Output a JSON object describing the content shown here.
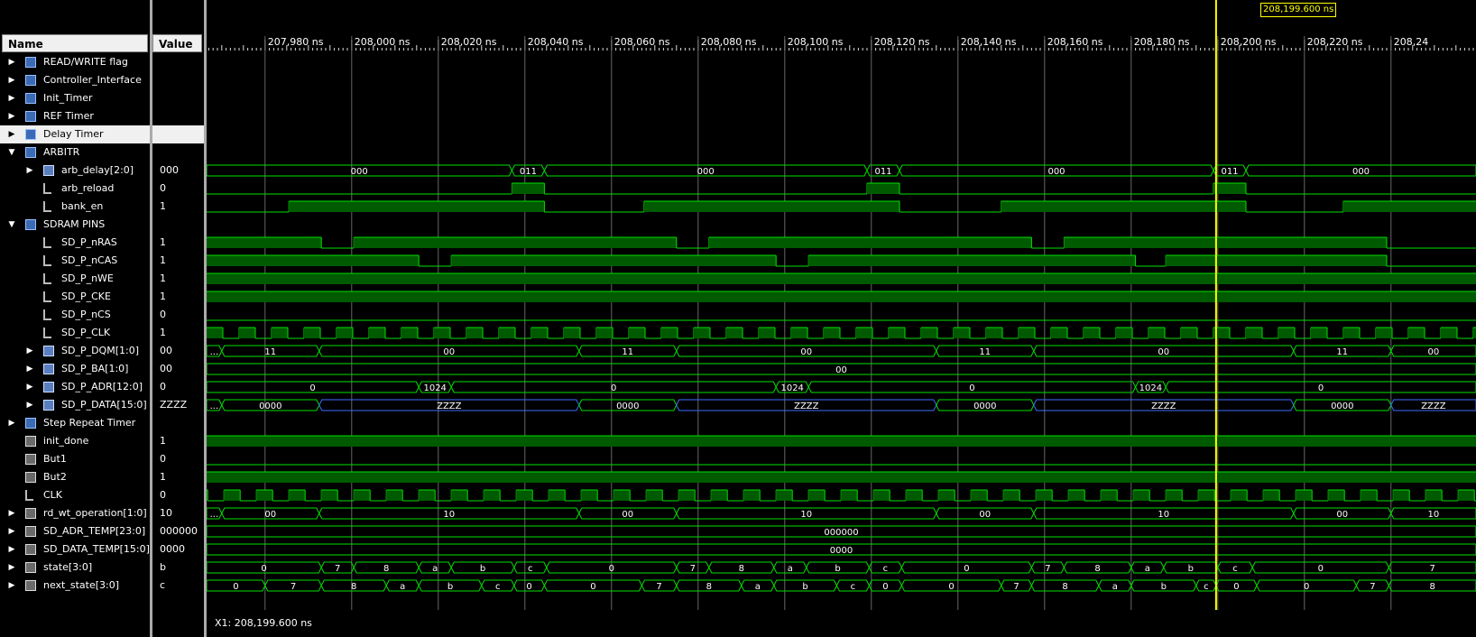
{
  "headers": {
    "name": "Name",
    "value": "Value"
  },
  "cursor": {
    "label": "208,199.600 ns",
    "x1": "X1: 208,199.600 ns"
  },
  "timeline": {
    "start_ns": 207966.5,
    "ticks": [
      {
        "t": 207980,
        "label": "207,980 ns"
      },
      {
        "t": 208000,
        "label": "208,000 ns"
      },
      {
        "t": 208020,
        "label": "208,020 ns"
      },
      {
        "t": 208040,
        "label": "208,040 ns"
      },
      {
        "t": 208060,
        "label": "208,060 ns"
      },
      {
        "t": 208080,
        "label": "208,080 ns"
      },
      {
        "t": 208100,
        "label": "208,100 ns"
      },
      {
        "t": 208120,
        "label": "208,120 ns"
      },
      {
        "t": 208140,
        "label": "208,140 ns"
      },
      {
        "t": 208160,
        "label": "208,160 ns"
      },
      {
        "t": 208180,
        "label": "208,180 ns"
      },
      {
        "t": 208200,
        "label": "208,200 ns"
      },
      {
        "t": 208220,
        "label": "208,220 ns"
      },
      {
        "t": 208240,
        "label": "208,24"
      }
    ]
  },
  "signals": [
    {
      "name": "READ/WRITE flag",
      "value": "",
      "icon": "group-icon",
      "level": 0,
      "expander": "collapsed"
    },
    {
      "name": "Controller_Interface",
      "value": "",
      "icon": "group-icon",
      "level": 0,
      "expander": "collapsed"
    },
    {
      "name": "Init_Timer",
      "value": "",
      "icon": "group-icon",
      "level": 0,
      "expander": "collapsed"
    },
    {
      "name": "REF Timer",
      "value": "",
      "icon": "group-icon",
      "level": 0,
      "expander": "collapsed"
    },
    {
      "name": "Delay Timer",
      "value": "",
      "icon": "group-icon",
      "level": 0,
      "expander": "collapsed",
      "selected": true
    },
    {
      "name": "ARBITR",
      "value": "",
      "icon": "group-icon",
      "level": 0,
      "expander": "expanded"
    },
    {
      "name": "arb_delay[2:0]",
      "value": "000",
      "icon": "bus-icon",
      "level": 1,
      "expander": "collapsed",
      "wave": {
        "kind": "bus",
        "segments": [
          {
            "t": 207966.5,
            "v": "000"
          },
          {
            "t": 208037,
            "v": "011"
          },
          {
            "t": 208044.5,
            "v": "000"
          },
          {
            "t": 208119,
            "v": "011"
          },
          {
            "t": 208126.5,
            "v": "000"
          },
          {
            "t": 208199,
            "v": "011"
          },
          {
            "t": 208206.5,
            "v": "000"
          }
        ]
      }
    },
    {
      "name": "arb_reload",
      "value": "0",
      "icon": "bit-icon",
      "level": 1,
      "expander": "none",
      "wave": {
        "kind": "bit",
        "init": 0,
        "edges": [
          208037,
          208044.5,
          208119,
          208126.5,
          208199,
          208206.5
        ]
      }
    },
    {
      "name": "bank_en",
      "value": "1",
      "icon": "bit-icon",
      "level": 1,
      "expander": "none",
      "wave": {
        "kind": "bit",
        "init": 0,
        "edges": [
          207985.5,
          208044.5,
          208067.5,
          208126.5,
          208150,
          208206.5,
          208229
        ]
      }
    },
    {
      "name": "SDRAM PINS",
      "value": "",
      "icon": "group-icon",
      "level": 0,
      "expander": "expanded"
    },
    {
      "name": "SD_P_nRAS",
      "value": "1",
      "icon": "bit-icon",
      "level": 1,
      "expander": "none",
      "wave": {
        "kind": "bit",
        "init": 1,
        "edges": [
          207993,
          208000.5,
          208075,
          208082.5,
          208157,
          208164.5,
          208239
        ]
      }
    },
    {
      "name": "SD_P_nCAS",
      "value": "1",
      "icon": "bit-icon",
      "level": 1,
      "expander": "none",
      "wave": {
        "kind": "bit",
        "init": 1,
        "edges": [
          208015.5,
          208023,
          208098,
          208105.5,
          208181,
          208188,
          208239
        ]
      }
    },
    {
      "name": "SD_P_nWE",
      "value": "1",
      "icon": "bit-icon",
      "level": 1,
      "expander": "none",
      "wave": {
        "kind": "bit",
        "init": 1,
        "edges": []
      }
    },
    {
      "name": "SD_P_CKE",
      "value": "1",
      "icon": "bit-icon",
      "level": 1,
      "expander": "none",
      "wave": {
        "kind": "bit",
        "init": 1,
        "edges": []
      }
    },
    {
      "name": "SD_P_nCS",
      "value": "0",
      "icon": "bit-icon",
      "level": 1,
      "expander": "none",
      "wave": {
        "kind": "bit",
        "init": 0,
        "edges": []
      }
    },
    {
      "name": "SD_P_CLK",
      "value": "1",
      "icon": "bit-icon",
      "level": 1,
      "expander": "none",
      "wave": {
        "kind": "clock",
        "first_rise": 207974,
        "half_period": 3.75
      }
    },
    {
      "name": "SD_P_DQM[1:0]",
      "value": "00",
      "icon": "bus-icon",
      "level": 1,
      "expander": "collapsed",
      "wave": {
        "kind": "bus",
        "segments": [
          {
            "t": 207966.5,
            "v": "..."
          },
          {
            "t": 207970,
            "v": "11"
          },
          {
            "t": 207992.5,
            "v": "00"
          },
          {
            "t": 208052.5,
            "v": "11"
          },
          {
            "t": 208075,
            "v": "00"
          },
          {
            "t": 208135,
            "v": "11"
          },
          {
            "t": 208157.5,
            "v": "00"
          },
          {
            "t": 208217.5,
            "v": "11"
          },
          {
            "t": 208240,
            "v": "00"
          }
        ]
      }
    },
    {
      "name": "SD_P_BA[1:0]",
      "value": "00",
      "icon": "bus-icon",
      "level": 1,
      "expander": "collapsed",
      "wave": {
        "kind": "bus",
        "segments": [
          {
            "t": 207966.5,
            "v": "00"
          }
        ]
      }
    },
    {
      "name": "SD_P_ADR[12:0]",
      "value": "0",
      "icon": "bus-icon",
      "level": 1,
      "expander": "collapsed",
      "wave": {
        "kind": "bus",
        "segments": [
          {
            "t": 207966.5,
            "v": "0"
          },
          {
            "t": 208015.5,
            "v": "1024"
          },
          {
            "t": 208023,
            "v": "0"
          },
          {
            "t": 208098,
            "v": "1024"
          },
          {
            "t": 208105.5,
            "v": "0"
          },
          {
            "t": 208181,
            "v": "1024"
          },
          {
            "t": 208188,
            "v": "0"
          }
        ]
      }
    },
    {
      "name": "SD_P_DATA[15:0]",
      "value": "ZZZZ",
      "icon": "bus-icon",
      "level": 1,
      "expander": "collapsed",
      "wave": {
        "kind": "bus",
        "segments": [
          {
            "t": 207966.5,
            "v": "..."
          },
          {
            "t": 207970,
            "v": "0000"
          },
          {
            "t": 207992.5,
            "v": "ZZZZ",
            "z": true
          },
          {
            "t": 208052.5,
            "v": "0000"
          },
          {
            "t": 208075,
            "v": "ZZZZ",
            "z": true
          },
          {
            "t": 208135,
            "v": "0000"
          },
          {
            "t": 208157.5,
            "v": "ZZZZ",
            "z": true
          },
          {
            "t": 208217.5,
            "v": "0000"
          },
          {
            "t": 208240,
            "v": "ZZZZ",
            "z": true
          }
        ]
      }
    },
    {
      "name": "Step Repeat Timer",
      "value": "",
      "icon": "group-icon",
      "level": 0,
      "expander": "collapsed"
    },
    {
      "name": "init_done",
      "value": "1",
      "icon": "in-icon",
      "level": 0,
      "expander": "none",
      "wave": {
        "kind": "bit",
        "init": 1,
        "edges": []
      }
    },
    {
      "name": "But1",
      "value": "0",
      "icon": "in-icon",
      "level": 0,
      "expander": "none",
      "wave": {
        "kind": "bit",
        "init": 0,
        "edges": []
      }
    },
    {
      "name": "But2",
      "value": "1",
      "icon": "in-icon",
      "level": 0,
      "expander": "none",
      "wave": {
        "kind": "bit",
        "init": 1,
        "edges": []
      }
    },
    {
      "name": "CLK",
      "value": "0",
      "icon": "bit-icon",
      "level": 0,
      "expander": "none",
      "wave": {
        "kind": "clock",
        "first_rise": 207970.5,
        "half_period": 3.75
      }
    },
    {
      "name": "rd_wt_operation[1:0]",
      "value": "10",
      "icon": "in-icon",
      "level": 0,
      "expander": "collapsed",
      "wave": {
        "kind": "bus",
        "segments": [
          {
            "t": 207966.5,
            "v": "..."
          },
          {
            "t": 207970,
            "v": "00"
          },
          {
            "t": 207992.5,
            "v": "10"
          },
          {
            "t": 208052.5,
            "v": "00"
          },
          {
            "t": 208075,
            "v": "10"
          },
          {
            "t": 208135,
            "v": "00"
          },
          {
            "t": 208157.5,
            "v": "10"
          },
          {
            "t": 208217.5,
            "v": "00"
          },
          {
            "t": 208240,
            "v": "10"
          }
        ]
      }
    },
    {
      "name": "SD_ADR_TEMP[23:0]",
      "value": "000000",
      "icon": "in-icon",
      "level": 0,
      "expander": "collapsed",
      "wave": {
        "kind": "bus",
        "segments": [
          {
            "t": 207966.5,
            "v": "000000"
          }
        ]
      }
    },
    {
      "name": "SD_DATA_TEMP[15:0]",
      "value": "0000",
      "icon": "in-icon",
      "level": 0,
      "expander": "collapsed",
      "wave": {
        "kind": "bus",
        "segments": [
          {
            "t": 207966.5,
            "v": "0000"
          }
        ]
      }
    },
    {
      "name": "state[3:0]",
      "value": "b",
      "icon": "in-icon",
      "level": 0,
      "expander": "collapsed",
      "wave": {
        "kind": "bus",
        "segments": [
          {
            "t": 207966.5,
            "v": "0"
          },
          {
            "t": 207993,
            "v": "7"
          },
          {
            "t": 208000.5,
            "v": "8"
          },
          {
            "t": 208015.5,
            "v": "a"
          },
          {
            "t": 208023,
            "v": "b"
          },
          {
            "t": 208037.5,
            "v": "c"
          },
          {
            "t": 208045,
            "v": "0"
          },
          {
            "t": 208075,
            "v": "7"
          },
          {
            "t": 208082.5,
            "v": "8"
          },
          {
            "t": 208097.5,
            "v": "a"
          },
          {
            "t": 208105,
            "v": "b"
          },
          {
            "t": 208119.5,
            "v": "c"
          },
          {
            "t": 208127,
            "v": "0"
          },
          {
            "t": 208157,
            "v": "7"
          },
          {
            "t": 208164.5,
            "v": "8"
          },
          {
            "t": 208180,
            "v": "a"
          },
          {
            "t": 208187.5,
            "v": "b"
          },
          {
            "t": 208200,
            "v": "c"
          },
          {
            "t": 208208,
            "v": "0"
          },
          {
            "t": 208239.5,
            "v": "7"
          }
        ]
      }
    },
    {
      "name": "next_state[3:0]",
      "value": "c",
      "icon": "in-icon",
      "level": 0,
      "expander": "collapsed",
      "wave": {
        "kind": "bus",
        "segments": [
          {
            "t": 207966.5,
            "v": "0"
          },
          {
            "t": 207980,
            "v": "7"
          },
          {
            "t": 207993,
            "v": "8"
          },
          {
            "t": 208008,
            "v": "a"
          },
          {
            "t": 208015.5,
            "v": "b"
          },
          {
            "t": 208030,
            "v": "c"
          },
          {
            "t": 208037.5,
            "v": "0"
          },
          {
            "t": 208044.5,
            "v": "0"
          },
          {
            "t": 208067,
            "v": "7"
          },
          {
            "t": 208075,
            "v": "8"
          },
          {
            "t": 208090,
            "v": "a"
          },
          {
            "t": 208097.5,
            "v": "b"
          },
          {
            "t": 208112,
            "v": "c"
          },
          {
            "t": 208119.5,
            "v": "0"
          },
          {
            "t": 208127,
            "v": "0"
          },
          {
            "t": 208150,
            "v": "7"
          },
          {
            "t": 208157,
            "v": "8"
          },
          {
            "t": 208172.5,
            "v": "a"
          },
          {
            "t": 208180,
            "v": "b"
          },
          {
            "t": 208195,
            "v": "c"
          },
          {
            "t": 208199.6,
            "v": "0"
          },
          {
            "t": 208209,
            "v": "0"
          },
          {
            "t": 208232,
            "v": "7"
          },
          {
            "t": 208239.5,
            "v": "8"
          }
        ]
      }
    }
  ],
  "colors": {
    "wave": "#00e000",
    "wave_fill": "#005a00",
    "z_line": "#3b6bff",
    "cursor": "#ffff00",
    "grid": "#666666"
  }
}
